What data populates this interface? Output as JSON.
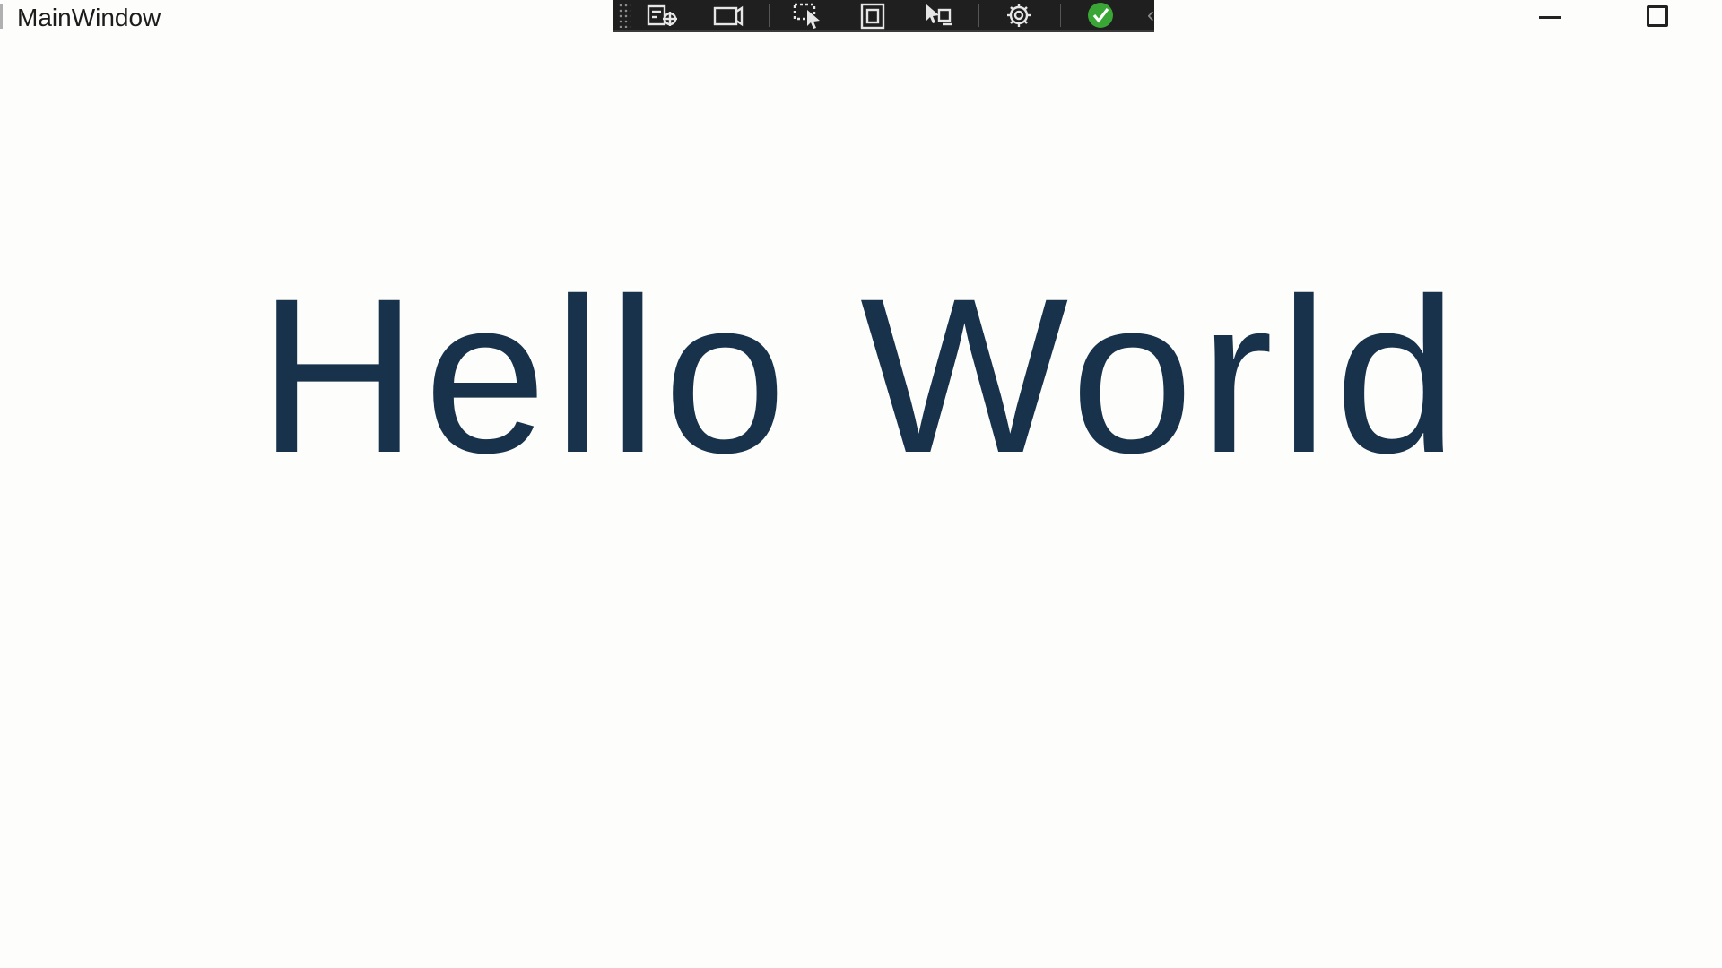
{
  "window": {
    "title": "MainWindow"
  },
  "devtools": {
    "tools": [
      {
        "name": "live-visual-tree-icon"
      },
      {
        "name": "track-focus-icon"
      },
      {
        "name": "select-element-icon"
      },
      {
        "name": "display-layout-adorners-icon"
      },
      {
        "name": "hot-reload-icon"
      },
      {
        "name": "settings-icon"
      },
      {
        "name": "verified-checkmark-icon"
      }
    ],
    "collapse_glyph": "‹"
  },
  "content": {
    "greeting": "Hello World"
  },
  "colors": {
    "text": "#17324a",
    "background": "#fdfdfb",
    "toolbar": "#1f1f1f",
    "check": "#3aa635"
  }
}
